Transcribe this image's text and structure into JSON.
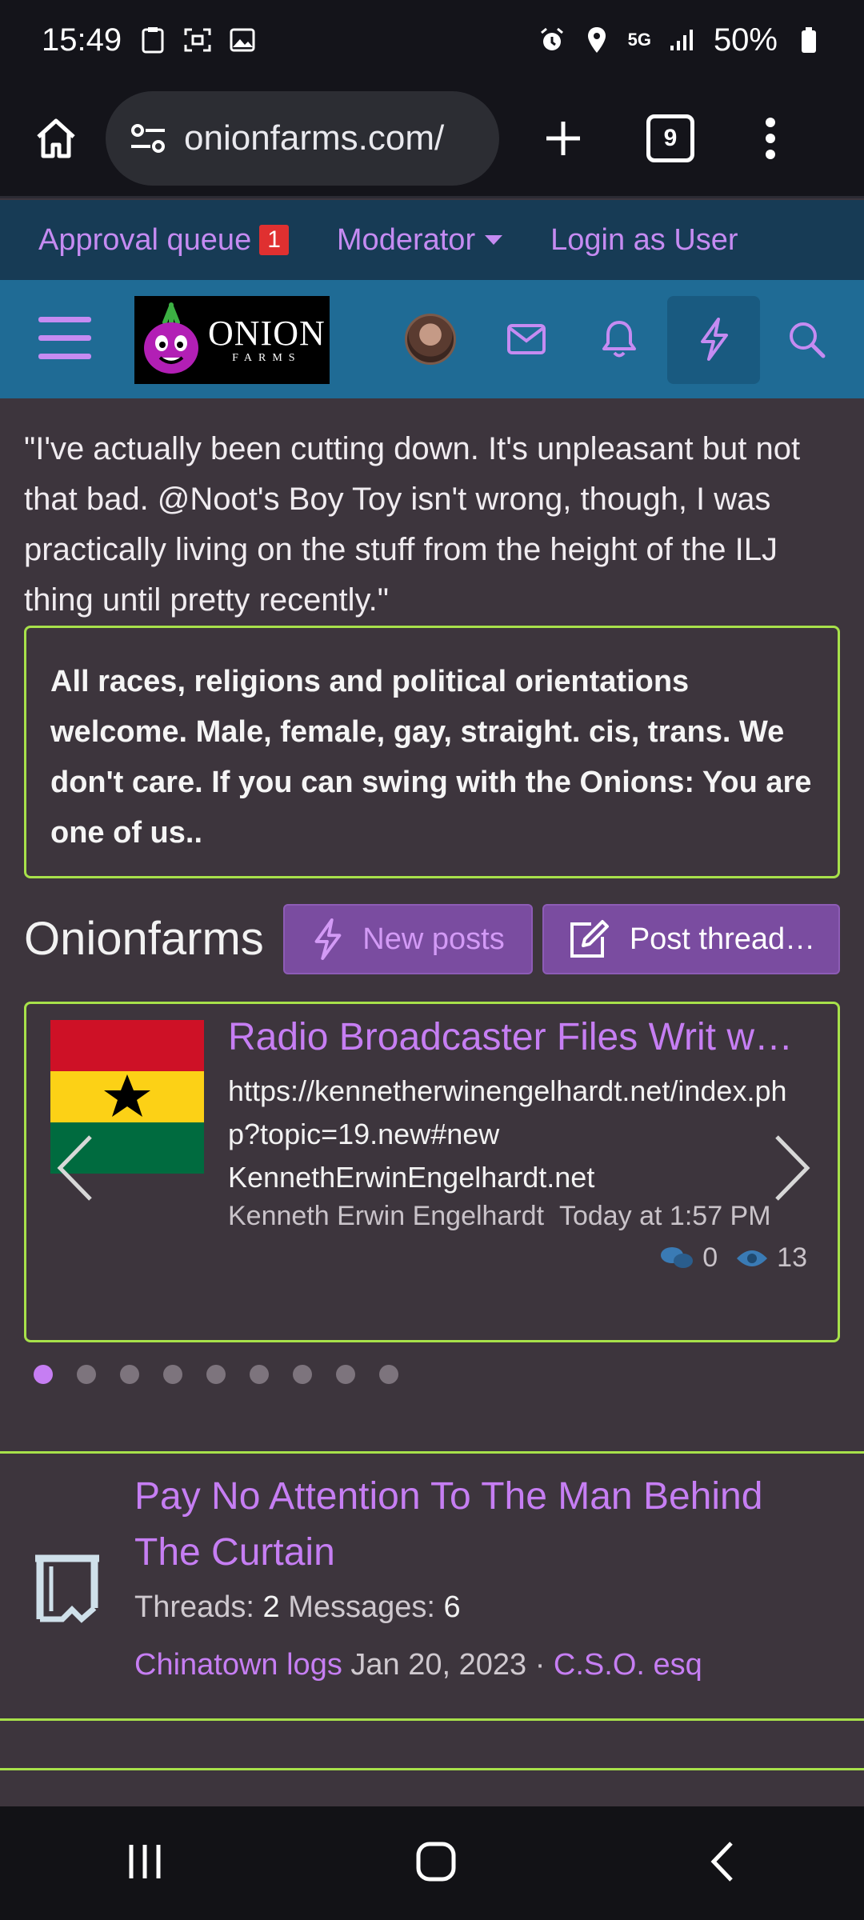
{
  "status_bar": {
    "time": "15:49",
    "battery": "50%",
    "network": "5G"
  },
  "browser": {
    "url": "onionfarms.com/",
    "tab_count": "9"
  },
  "moderator_bar": {
    "approval_label": "Approval queue",
    "approval_count": "1",
    "moderator_label": "Moderator",
    "login_as_user_label": "Login as User"
  },
  "nav": {
    "logo_text": "ONION",
    "logo_subtext": "FARMS"
  },
  "quote_text": "\"I've actually been cutting down. It's unpleasant but not that bad. @Noot's Boy Toy isn't wrong, though, I was practically living on the stuff from the height of the ILJ thing until pretty recently.\"",
  "notice_text": "All races, religions and political orientations welcome. Male, female, gay, straight. cis, trans. We don't care. If you can swing with the Onions: You are one of us..",
  "section": {
    "title": "Onionfarms",
    "new_posts_label": "New posts",
    "post_thread_label": "Post thread…"
  },
  "carousel": {
    "title": "Radio Broadcaster Files Writ w…",
    "body_line1": "https://kennetherwinengelhardt.net/index.php?topic=19.new#new",
    "body_line2": "KennethErwinEngelhardt.net",
    "author": "Kenneth Erwin Engelhardt",
    "time": "Today at 1:57 PM",
    "replies": "0",
    "views": "13",
    "page_count": 9,
    "active_page": 1
  },
  "forum": {
    "title": "Pay No Attention To The Man Behind The Curtain",
    "threads_label": "Threads:",
    "threads_value": "2",
    "messages_label": "Messages:",
    "messages_value": "6",
    "last_thread": "Chinatown logs",
    "last_date": "Jan 20, 2023",
    "separator": "·",
    "last_user": "C.S.O. esq"
  },
  "colors": {
    "accent_purple": "#c67ef3",
    "border_green": "#a7e14a",
    "nav_blue": "#1f6b95",
    "mod_bar": "#173b55",
    "page_bg": "#3d353d"
  }
}
